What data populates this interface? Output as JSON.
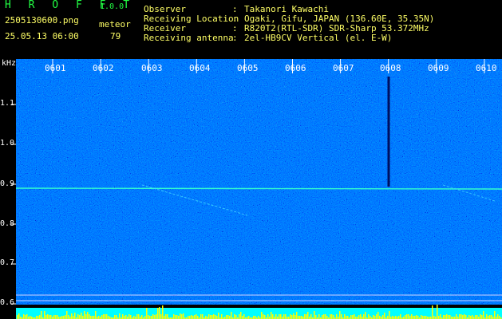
{
  "header": {
    "app_title": "H R O F F T",
    "version": "1.0.0",
    "file_name": "2505130600.png",
    "meteor_label": "meteor",
    "meteor_count": "79",
    "timestamp": "25.05.13 06:00"
  },
  "info": {
    "observer_label": "Observer",
    "observer": "Takanori Kawachi",
    "location_label": "Receiving Location",
    "location": "Ogaki, Gifu, JAPAN (136.60E, 35.35N)",
    "receiver_label": "Receiver",
    "receiver": "R820T2(RTL-SDR) SDR-Sharp 53.372MHz",
    "antenna_label": "Receiving antenna",
    "antenna": "2el-HB9CV Vertical (el. E-W)",
    "separator": ":"
  },
  "axis": {
    "unit": "kHz",
    "hour_labels": [
      "0601",
      "0602",
      "0603",
      "0604",
      "0605",
      "0606",
      "0607",
      "0608",
      "0609",
      "0610"
    ],
    "freq_labels": [
      "1.1",
      "1.0",
      "0.9",
      "0.8",
      "0.7",
      "0.6"
    ]
  },
  "colors": {
    "background": "#000000",
    "waterfall_base": "#0a1a8c",
    "title_green": "#22ff44",
    "text_yellow": "#ffff66",
    "bar_yellow": "#ffff00",
    "bar_cyan": "#00ffff"
  }
}
